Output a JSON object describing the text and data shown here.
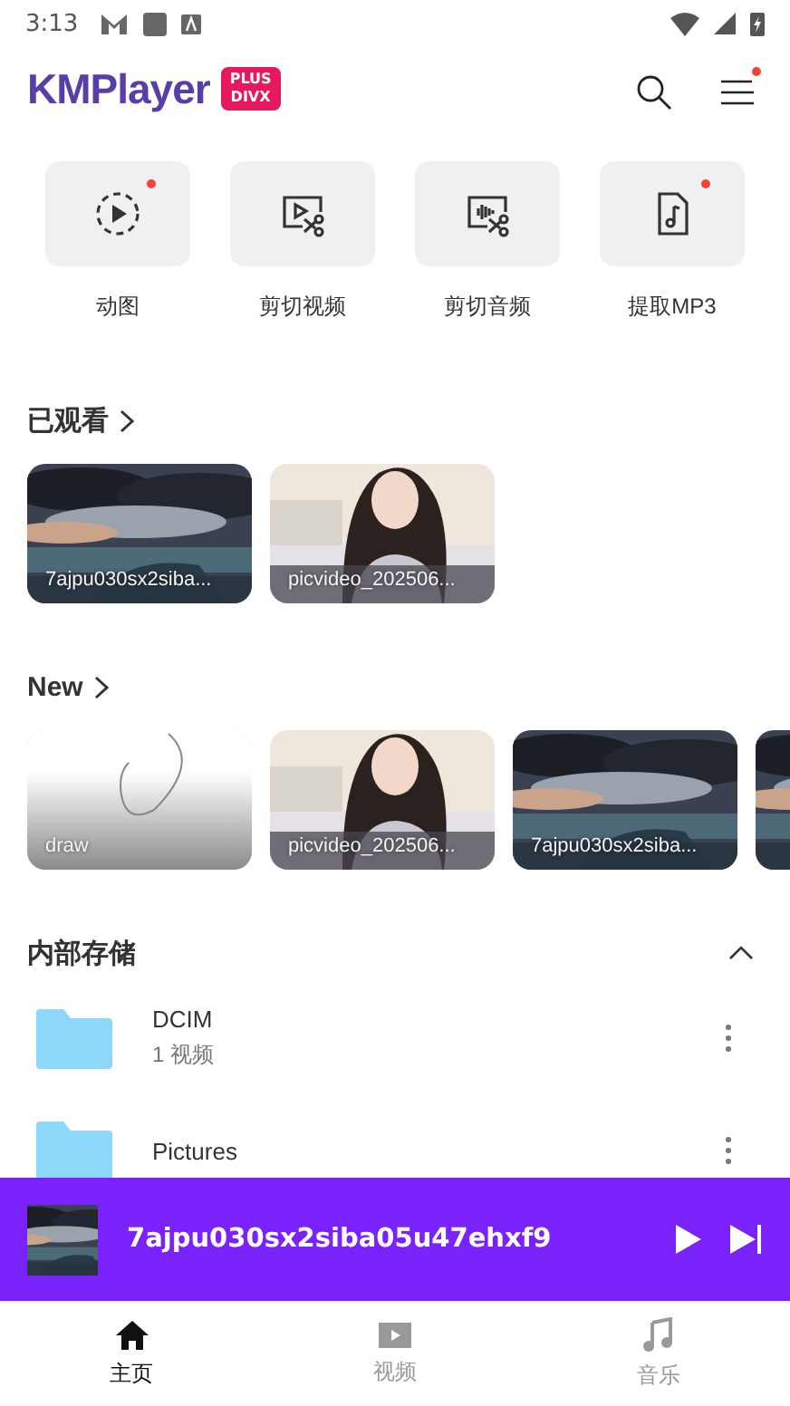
{
  "status_bar": {
    "time": "3:13"
  },
  "header": {
    "logo": "KMPlayer",
    "badge_top": "PLUS",
    "badge_bottom": "DIVX",
    "menu_dot": true
  },
  "tools": [
    {
      "kind": "gif",
      "label": "动图",
      "dot": true
    },
    {
      "kind": "cut_video",
      "label": "剪切视频",
      "dot": false
    },
    {
      "kind": "cut_audio",
      "label": "剪切音频",
      "dot": false
    },
    {
      "kind": "mp3",
      "label": "提取MP3",
      "dot": true
    }
  ],
  "sections": [
    {
      "title": "已观看",
      "items": [
        {
          "kind": "clouds",
          "title": "7ajpu030sx2siba..."
        },
        {
          "kind": "person",
          "title": "picvideo_202506..."
        }
      ]
    },
    {
      "title": "New",
      "items": [
        {
          "kind": "sketch",
          "title": "draw"
        },
        {
          "kind": "person",
          "title": "picvideo_202506..."
        },
        {
          "kind": "clouds",
          "title": "7ajpu030sx2siba..."
        },
        {
          "kind": "clouds"
        }
      ]
    }
  ],
  "storage": {
    "title": "内部存储",
    "expanded": true,
    "folders": [
      {
        "name": "DCIM",
        "count": "1 视频"
      },
      {
        "name": "Pictures"
      }
    ]
  },
  "mini_player": {
    "title": "7ajpu030sx2siba05u47ehxf9"
  },
  "nav": [
    {
      "kind": "home",
      "label": "主页",
      "selected": true
    },
    {
      "kind": "video",
      "label": "视频",
      "selected": false
    },
    {
      "kind": "music",
      "label": "音乐",
      "selected": false
    }
  ]
}
